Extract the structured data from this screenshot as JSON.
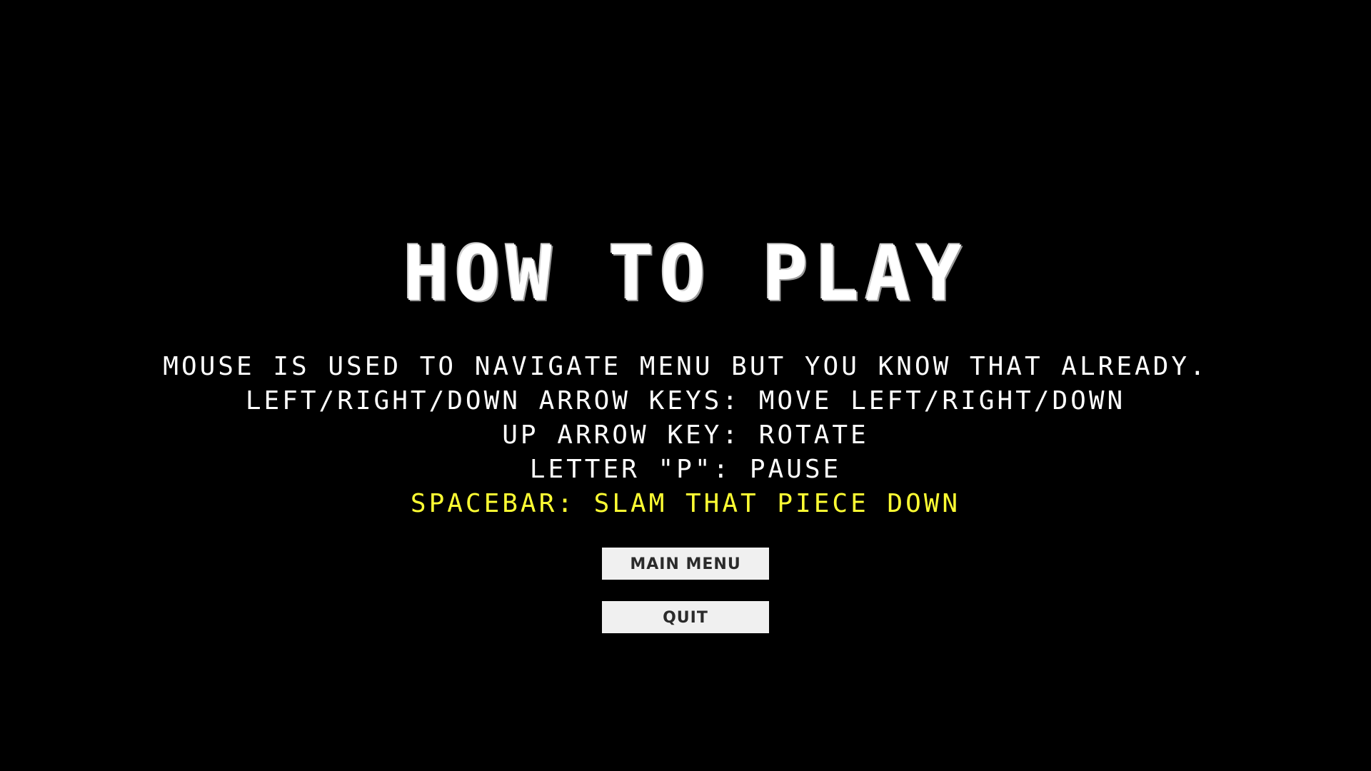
{
  "title": "HOW TO PLAY",
  "instructions": [
    "MOUSE IS USED TO NAVIGATE MENU BUT YOU KNOW THAT ALREADY.",
    "LEFT/RIGHT/DOWN ARROW KEYS: MOVE LEFT/RIGHT/DOWN",
    "UP ARROW KEY: ROTATE",
    "LETTER \"P\": PAUSE",
    "SPACEBAR: SLAM THAT PIECE DOWN"
  ],
  "buttons": {
    "main_menu": "MAIN MENU",
    "quit": "QUIT"
  },
  "colors": {
    "background": "#000000",
    "text": "#ffffff",
    "highlight": "#ffff33",
    "button_bg": "#f0f0f0",
    "button_text": "#2b2b2b"
  }
}
